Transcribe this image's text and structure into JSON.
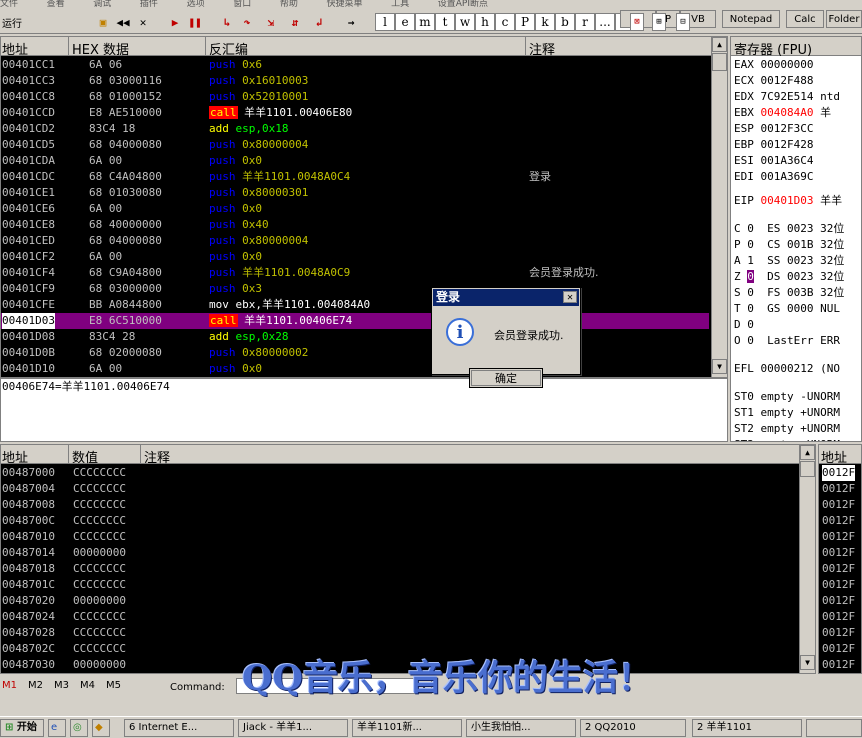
{
  "menu": [
    "文件",
    "查看",
    "调试",
    "插件",
    "选项",
    "窗口",
    "帮助",
    "快捷菜单",
    "工具",
    "设置API断点"
  ],
  "toolbar": {
    "run_label": "运行",
    "letters": [
      "l",
      "e",
      "m",
      "t",
      "w",
      "h",
      "c",
      "P",
      "k",
      "b",
      "r",
      "...",
      "s"
    ],
    "right_buttons": [
      "BP",
      "P",
      "VB",
      "Notepad",
      "Calc",
      "Folder"
    ]
  },
  "disasm": {
    "headers": {
      "addr": "地址",
      "hex": "HEX 数据",
      "disasm": "反汇编",
      "comment": "注释"
    },
    "rows": [
      {
        "addr": "00401CC1",
        "hex": "6A 06",
        "op": "push",
        "arg": "0x6",
        "comment": ""
      },
      {
        "addr": "00401CC3",
        "hex": "68 03000116",
        "op": "push",
        "arg": "0x16010003",
        "comment": ""
      },
      {
        "addr": "00401CC8",
        "hex": "68 01000152",
        "op": "push",
        "arg": "0x52010001",
        "comment": ""
      },
      {
        "addr": "00401CCD",
        "hex": "E8 AE510000",
        "op": "call",
        "arg": "羊羊1101.00406E80",
        "comment": ""
      },
      {
        "addr": "00401CD2",
        "hex": "83C4 18",
        "op": "add",
        "arg": "esp,0x18",
        "comment": ""
      },
      {
        "addr": "00401CD5",
        "hex": "68 04000080",
        "op": "push",
        "arg": "0x80000004",
        "comment": ""
      },
      {
        "addr": "00401CDA",
        "hex": "6A 00",
        "op": "push",
        "arg": "0x0",
        "comment": ""
      },
      {
        "addr": "00401CDC",
        "hex": "68 C4A04800",
        "op": "push",
        "arg": "羊羊1101.0048A0C4",
        "comment": "登录"
      },
      {
        "addr": "00401CE1",
        "hex": "68 01030080",
        "op": "push",
        "arg": "0x80000301",
        "comment": ""
      },
      {
        "addr": "00401CE6",
        "hex": "6A 00",
        "op": "push",
        "arg": "0x0",
        "comment": ""
      },
      {
        "addr": "00401CE8",
        "hex": "68 40000000",
        "op": "push",
        "arg": "0x40",
        "comment": ""
      },
      {
        "addr": "00401CED",
        "hex": "68 04000080",
        "op": "push",
        "arg": "0x80000004",
        "comment": ""
      },
      {
        "addr": "00401CF2",
        "hex": "6A 00",
        "op": "push",
        "arg": "0x0",
        "comment": ""
      },
      {
        "addr": "00401CF4",
        "hex": "68 C9A04800",
        "op": "push",
        "arg": "羊羊1101.0048A0C9",
        "comment": "会员登录成功."
      },
      {
        "addr": "00401CF9",
        "hex": "68 03000000",
        "op": "push",
        "arg": "0x3",
        "comment": ""
      },
      {
        "addr": "00401CFE",
        "hex": "BB A0844800",
        "op": "mov",
        "arg": "ebx,羊羊1101.004084A0",
        "comment": ""
      },
      {
        "addr": "00401D03",
        "hex": "E8 6C510000",
        "op": "call",
        "arg": "羊羊1101.00406E74",
        "comment": "",
        "selected": true
      },
      {
        "addr": "00401D08",
        "hex": "83C4 28",
        "op": "add",
        "arg": "esp,0x28",
        "comment": ""
      },
      {
        "addr": "00401D0B",
        "hex": "68 02000080",
        "op": "push",
        "arg": "0x80000002",
        "comment": ""
      },
      {
        "addr": "00401D10",
        "hex": "6A 00",
        "op": "push",
        "arg": "0x0",
        "comment": ""
      }
    ],
    "info_line": "00406E74=羊羊1101.00406E74"
  },
  "registers": {
    "title": "寄存器 (FPU)",
    "gp": [
      {
        "name": "EAX",
        "value": "00000000",
        "note": ""
      },
      {
        "name": "ECX",
        "value": "0012F488",
        "note": ""
      },
      {
        "name": "EDX",
        "value": "7C92E514",
        "note": "ntd"
      },
      {
        "name": "EBX",
        "value": "004084A0",
        "note": "羊",
        "changed": true
      },
      {
        "name": "ESP",
        "value": "0012F3CC",
        "note": ""
      },
      {
        "name": "EBP",
        "value": "0012F428",
        "note": ""
      },
      {
        "name": "ESI",
        "value": "001A36C4",
        "note": ""
      },
      {
        "name": "EDI",
        "value": "001A369C",
        "note": ""
      }
    ],
    "eip": {
      "name": "EIP",
      "value": "00401D03",
      "note": "羊羊"
    },
    "flags": [
      {
        "f": "C",
        "v": "0",
        "seg": "ES",
        "sv": "0023",
        "bits": "32位"
      },
      {
        "f": "P",
        "v": "0",
        "seg": "CS",
        "sv": "001B",
        "bits": "32位"
      },
      {
        "f": "A",
        "v": "1",
        "seg": "SS",
        "sv": "0023",
        "bits": "32位"
      },
      {
        "f": "Z",
        "v": "0",
        "seg": "DS",
        "sv": "0023",
        "bits": "32位"
      },
      {
        "f": "S",
        "v": "0",
        "seg": "FS",
        "sv": "003B",
        "bits": "32位"
      },
      {
        "f": "T",
        "v": "0",
        "seg": "GS",
        "sv": "0000",
        "bits": "NUL"
      },
      {
        "f": "D",
        "v": "0",
        "seg": "",
        "sv": "",
        "bits": ""
      },
      {
        "f": "O",
        "v": "0",
        "seg": "LastErr",
        "sv": "",
        "bits": "ERR"
      }
    ],
    "efl": "EFL 00000212 (NO",
    "fpu": [
      "ST0 empty -UNORM",
      "ST1 empty +UNORM",
      "ST2 empty +UNORM",
      "ST3 empty +UNORM"
    ]
  },
  "dump": {
    "headers": {
      "addr": "地址",
      "value": "数值",
      "comment": "注释"
    },
    "rows": [
      {
        "addr": "00487000",
        "value": "CCCCCCCC"
      },
      {
        "addr": "00487004",
        "value": "CCCCCCCC"
      },
      {
        "addr": "00487008",
        "value": "CCCCCCCC"
      },
      {
        "addr": "0048700C",
        "value": "CCCCCCCC"
      },
      {
        "addr": "00487010",
        "value": "CCCCCCCC"
      },
      {
        "addr": "00487014",
        "value": "00000000"
      },
      {
        "addr": "00487018",
        "value": "CCCCCCCC"
      },
      {
        "addr": "0048701C",
        "value": "CCCCCCCC"
      },
      {
        "addr": "00487020",
        "value": "00000000"
      },
      {
        "addr": "00487024",
        "value": "CCCCCCCC"
      },
      {
        "addr": "00487028",
        "value": "CCCCCCCC"
      },
      {
        "addr": "0048702C",
        "value": "CCCCCCCC"
      },
      {
        "addr": "00487030",
        "value": "00000000"
      }
    ]
  },
  "stack": {
    "header": "地址",
    "rows": [
      "0012F",
      "0012F",
      "0012F",
      "0012F",
      "0012F",
      "0012F",
      "0012F",
      "0012F",
      "0012F",
      "0012F",
      "0012F",
      "0012F",
      "0012F"
    ]
  },
  "dialog": {
    "title": "登录",
    "message": "会员登录成功.",
    "ok_label": "确定",
    "close_glyph": "✕",
    "icon_glyph": "i"
  },
  "statusbar": {
    "tabs": [
      "M1",
      "M2",
      "M3",
      "M4",
      "M5"
    ],
    "command_label": "Command:"
  },
  "overlay_text": "QQ音乐，音乐你的生活！",
  "taskbar": {
    "start_label": "开始",
    "tasks": [
      "6 Internet E...",
      "Jiack  - 羊羊1...",
      "羊羊1101新...",
      "小生我怕怕...",
      "2 QQ2010",
      "2 羊羊1101"
    ]
  },
  "colors": {
    "selected_row": "#800080",
    "call_bg": "#ff0000",
    "titlebar": "#0a246a"
  }
}
